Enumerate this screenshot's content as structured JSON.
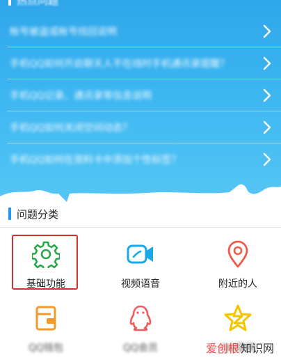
{
  "hot": {
    "title": "热点问题",
    "questions": [
      {
        "text": "帐号被盗或帐号找回说明"
      },
      {
        "text": "手机QQ如何开启聊天人不在线时手机通讯录提醒？"
      },
      {
        "text": "手机QQ记录、通讯录等信息说明"
      },
      {
        "text": "手机QQ如何关闭空间动态？"
      },
      {
        "text": "手机QQ如何在资料卡中添加个性标签？"
      }
    ]
  },
  "categories": {
    "title": "问题分类",
    "items": [
      {
        "label": "基础功能",
        "icon": "gear-icon",
        "color": "#2aa84a",
        "selected": true
      },
      {
        "label": "视频语音",
        "icon": "video-camera-icon",
        "color": "#18a9e6"
      },
      {
        "label": "附近的人",
        "icon": "location-pin-icon",
        "color": "#f05a4a"
      },
      {
        "label": "QQ钱包",
        "icon": "wallet-icon",
        "color": "#f39a2c"
      },
      {
        "label": "QQ会员",
        "icon": "penguin-icon",
        "color": "#ef5b5b"
      },
      {
        "label": "QQ空间",
        "icon": "star-z-icon",
        "color": "#f5c400"
      }
    ]
  },
  "watermark": {
    "brand": "爱创根",
    "site": "知识网"
  },
  "colors": {
    "header_blue": "#2fa6ea",
    "accent": "#2196f3",
    "highlight": "#d43030"
  }
}
